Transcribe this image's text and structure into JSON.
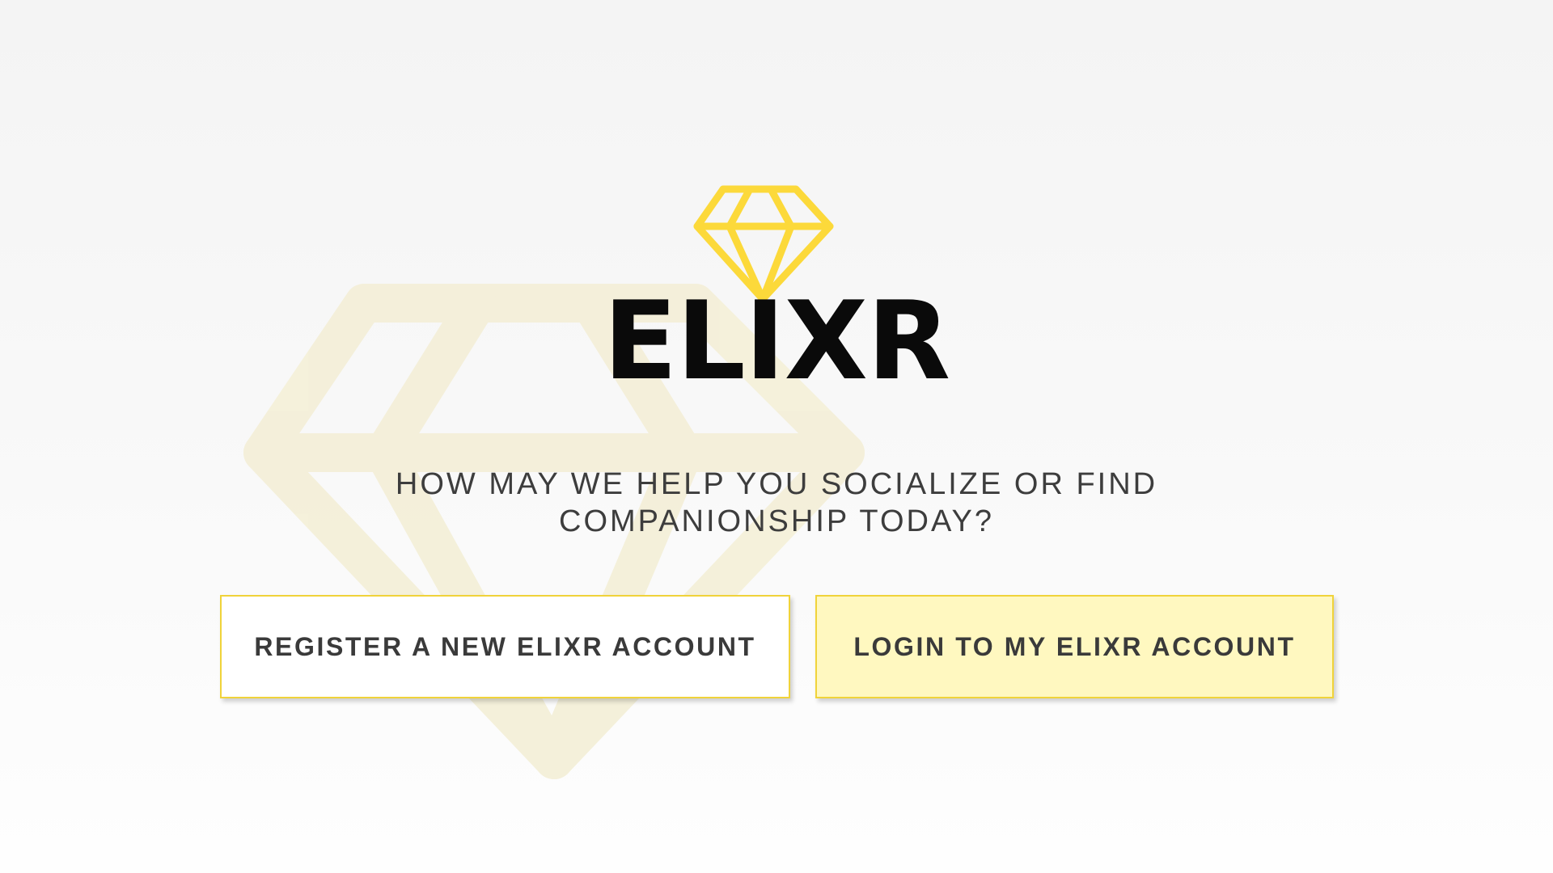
{
  "brand": {
    "name": "ELIXR",
    "logo_icon": "diamond-icon",
    "accent_color": "#fcd93a",
    "watermark_icon": "diamond-icon"
  },
  "tagline": {
    "line1": "HOW MAY WE HELP YOU SOCIALIZE OR FIND",
    "line2": "COMPANIONSHIP TODAY?"
  },
  "actions": {
    "register_label": "REGISTER A NEW ELIXR ACCOUNT",
    "login_label": "LOGIN TO MY ELIXR ACCOUNT",
    "register_bg": "#ffffff",
    "login_bg": "#fff8c0",
    "border_color": "#f0d33a"
  }
}
